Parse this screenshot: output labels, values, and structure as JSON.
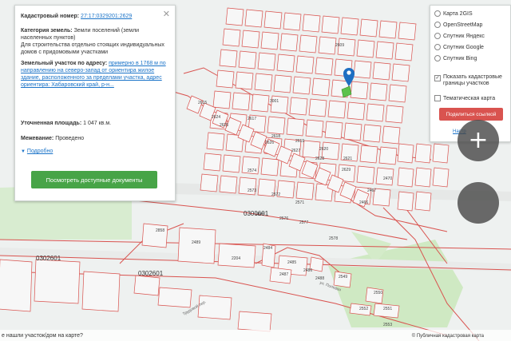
{
  "map": {
    "parcels": [
      "2609",
      "2615",
      "2624",
      "2625",
      "2617",
      "2618",
      "2619",
      "2620",
      "2621",
      "2626",
      "2627",
      "2628",
      "2629",
      "2574",
      "2573",
      "2572",
      "2571",
      "2575",
      "2576",
      "2577",
      "2578",
      "2858",
      "2489",
      "2204",
      "2484",
      "2485",
      "2486",
      "2487",
      "2488",
      "2549",
      "2550",
      "2551",
      "2552",
      "2553",
      "3001",
      "2470",
      "2467",
      "2466"
    ],
    "zones": [
      "0300601",
      "0302601",
      "0302601"
    ]
  },
  "popup": {
    "cadastral_label": "Кадастровый номер:",
    "cadastral_number": "27:17:0329201:2629",
    "category_label": "Категория земель:",
    "category_value": "Земли поселений (земли населенных пунктов)",
    "use_text": "Для строительства отдельно стоящих индивидуальных домов с придомовыми участками",
    "address_label": "Земельный участок по адресу:",
    "address_value": "примерно в 1768 м по направлению на северо-запад от ориентира жилое здание, расположенного за пределами участка, адрес ориентира: Хабаровский край, р-н...",
    "area_label": "Уточненная площадь:",
    "area_value": "1 047 кв.м.",
    "survey_label": "Межевание:",
    "survey_value": "Проведено",
    "more_label": "Подробно",
    "docs_button": "Посмотреть доступные документы",
    "close_icon": "close-icon"
  },
  "layers": {
    "options": [
      "Карта 2GIS",
      "OpenStreetMap",
      "Спутник Яндекс",
      "Спутник Google",
      "Спутник Bing"
    ],
    "selected": "",
    "show_cadastral": "Показать кадастровые границы участков",
    "show_cadastral_checked": true,
    "thematic": "Тематическая карта",
    "thematic_checked": false,
    "share_button": "Поделиться ссылкой",
    "small_link": "Настр"
  },
  "zoom": {
    "plus": "+",
    "minus": ""
  },
  "footer": {
    "question": "е нашли участок/дом на карте?",
    "attribution": "© Публичная кадастровая карта"
  },
  "colors": {
    "parcel_line": "#d9534f",
    "marker": "#1f6fc2",
    "selected_parcel": "#5cc24b",
    "docs_button": "#47a447",
    "share_button": "#d9534f",
    "green_area": "#cfe9c3",
    "link": "#1a73c8"
  }
}
